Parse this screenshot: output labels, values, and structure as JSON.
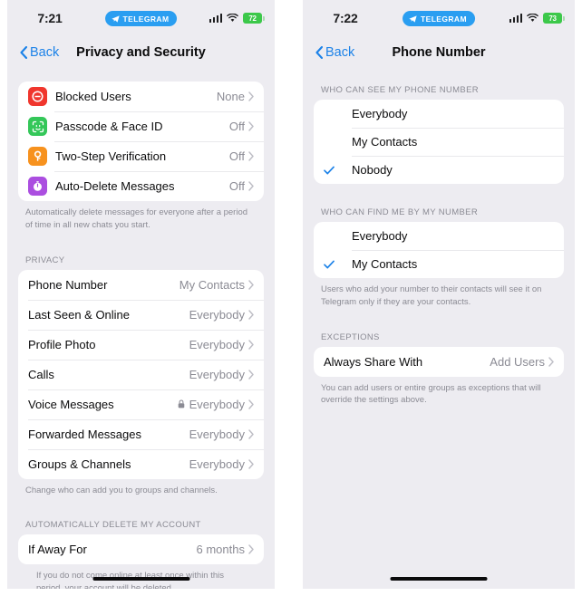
{
  "screens": [
    {
      "status": {
        "time": "7:21",
        "badge_label": "TELEGRAM",
        "battery_level": "72"
      },
      "nav": {
        "back_label": "Back",
        "title": "Privacy and Security"
      },
      "security_group": {
        "rows": [
          {
            "label": "Blocked Users",
            "value": "None",
            "icon": "block-icon",
            "icon_color": "#f0362d"
          },
          {
            "label": "Passcode & Face ID",
            "value": "Off",
            "icon": "face-id-icon",
            "icon_color": "#34c759"
          },
          {
            "label": "Two-Step Verification",
            "value": "Off",
            "icon": "key-icon",
            "icon_color": "#f7921e"
          },
          {
            "label": "Auto-Delete Messages",
            "value": "Off",
            "icon": "timer-icon",
            "icon_color": "#ab4ee0"
          }
        ],
        "footer": "Automatically delete messages for everyone after a period of time in all new chats you start."
      },
      "privacy_group": {
        "header": "PRIVACY",
        "rows": [
          {
            "label": "Phone Number",
            "value": "My Contacts",
            "locked": false
          },
          {
            "label": "Last Seen & Online",
            "value": "Everybody",
            "locked": false
          },
          {
            "label": "Profile Photo",
            "value": "Everybody",
            "locked": false
          },
          {
            "label": "Calls",
            "value": "Everybody",
            "locked": false
          },
          {
            "label": "Voice Messages",
            "value": "Everybody",
            "locked": true
          },
          {
            "label": "Forwarded Messages",
            "value": "Everybody",
            "locked": false
          },
          {
            "label": "Groups & Channels",
            "value": "Everybody",
            "locked": false
          }
        ],
        "footer": "Change who can add you to groups and channels."
      },
      "delete_group": {
        "header": "AUTOMATICALLY DELETE MY ACCOUNT",
        "rows": [
          {
            "label": "If Away For",
            "value": "6 months"
          }
        ],
        "cutoff_text": "If you do not come online at least once within this period, your account will be deleted"
      }
    },
    {
      "status": {
        "time": "7:22",
        "badge_label": "TELEGRAM",
        "battery_level": "73"
      },
      "nav": {
        "back_label": "Back",
        "title": "Phone Number"
      },
      "see_group": {
        "header": "WHO CAN SEE MY PHONE NUMBER",
        "options": [
          {
            "label": "Everybody",
            "selected": false
          },
          {
            "label": "My Contacts",
            "selected": false
          },
          {
            "label": "Nobody",
            "selected": true
          }
        ]
      },
      "find_group": {
        "header": "WHO CAN FIND ME BY MY NUMBER",
        "options": [
          {
            "label": "Everybody",
            "selected": false
          },
          {
            "label": "My Contacts",
            "selected": true
          }
        ],
        "footer": "Users who add your number to their contacts will see it on Telegram only if they are your contacts."
      },
      "exceptions_group": {
        "header": "EXCEPTIONS",
        "rows": [
          {
            "label": "Always Share With",
            "value": "Add Users"
          }
        ],
        "footer": "You can add users or entire groups as exceptions that will override the settings above."
      }
    }
  ],
  "colors": {
    "accent": "#1c82e8",
    "background": "#edecf1",
    "card": "#ffffff",
    "secondary_text": "#8b8b94",
    "telegram_blue": "#2a9ef1",
    "battery_green": "#3cc84a"
  }
}
